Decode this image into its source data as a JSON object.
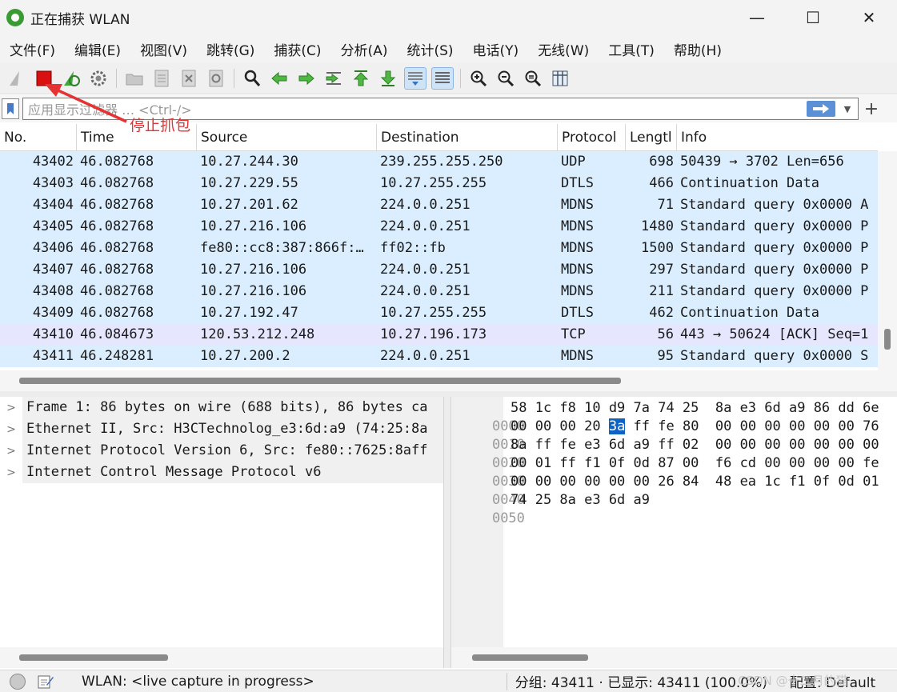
{
  "window": {
    "title": "正在捕获 WLAN",
    "minimize": "—",
    "maximize": "☐",
    "close": "✕"
  },
  "menu": [
    "文件(F)",
    "编辑(E)",
    "视图(V)",
    "跳转(G)",
    "捕获(C)",
    "分析(A)",
    "统计(S)",
    "电话(Y)",
    "无线(W)",
    "工具(T)",
    "帮助(H)"
  ],
  "filter": {
    "placeholder": "应用显示过滤器 … <Ctrl-/>",
    "add": "+"
  },
  "annotation": {
    "label": "停止抓包",
    "color": "#e53333"
  },
  "packet_list": {
    "columns": [
      "No.",
      "Time",
      "Source",
      "Destination",
      "Protocol",
      "Lengtl",
      "Info"
    ],
    "rows": [
      {
        "no": "43402",
        "time": "46.082768",
        "src": "10.27.244.30",
        "dst": "239.255.255.250",
        "proto": "UDP",
        "len": "698",
        "info": "50439 → 3702 Len=656",
        "kind": "udp"
      },
      {
        "no": "43403",
        "time": "46.082768",
        "src": "10.27.229.55",
        "dst": "10.27.255.255",
        "proto": "DTLS",
        "len": "466",
        "info": "Continuation Data",
        "kind": "udp"
      },
      {
        "no": "43404",
        "time": "46.082768",
        "src": "10.27.201.62",
        "dst": "224.0.0.251",
        "proto": "MDNS",
        "len": "71",
        "info": "Standard query 0x0000 A",
        "kind": "udp"
      },
      {
        "no": "43405",
        "time": "46.082768",
        "src": "10.27.216.106",
        "dst": "224.0.0.251",
        "proto": "MDNS",
        "len": "1480",
        "info": "Standard query 0x0000 P",
        "kind": "udp"
      },
      {
        "no": "43406",
        "time": "46.082768",
        "src": "fe80::cc8:387:866f:…",
        "dst": "ff02::fb",
        "proto": "MDNS",
        "len": "1500",
        "info": "Standard query 0x0000 P",
        "kind": "udp"
      },
      {
        "no": "43407",
        "time": "46.082768",
        "src": "10.27.216.106",
        "dst": "224.0.0.251",
        "proto": "MDNS",
        "len": "297",
        "info": "Standard query 0x0000 P",
        "kind": "udp"
      },
      {
        "no": "43408",
        "time": "46.082768",
        "src": "10.27.216.106",
        "dst": "224.0.0.251",
        "proto": "MDNS",
        "len": "211",
        "info": "Standard query 0x0000 P",
        "kind": "udp"
      },
      {
        "no": "43409",
        "time": "46.082768",
        "src": "10.27.192.47",
        "dst": "10.27.255.255",
        "proto": "DTLS",
        "len": "462",
        "info": "Continuation Data",
        "kind": "udp"
      },
      {
        "no": "43410",
        "time": "46.084673",
        "src": "120.53.212.248",
        "dst": "10.27.196.173",
        "proto": "TCP",
        "len": "56",
        "info": "443 → 50624 [ACK] Seq=1",
        "kind": "tcp"
      },
      {
        "no": "43411",
        "time": "46.248281",
        "src": "10.27.200.2",
        "dst": "224.0.0.251",
        "proto": "MDNS",
        "len": "95",
        "info": "Standard query 0x0000 S",
        "kind": "udp"
      }
    ],
    "colors": {
      "udp": "#daeeff",
      "tcp": "#e7e6ff"
    }
  },
  "details": [
    "Frame 1: 86 bytes on wire (688 bits), 86 bytes ca",
    "Ethernet II, Src: H3CTechnolog_e3:6d:a9 (74:25:8a",
    "Internet Protocol Version 6, Src: fe80::7625:8aff",
    "Internet Control Message Protocol v6"
  ],
  "bytes": [
    {
      "offset": "0000",
      "hex_a": "58 1c f8 10 d9 7a 74 25  8a e3 6d a9 86 dd 6e",
      "sel": "",
      "hex_b": ""
    },
    {
      "offset": "0010",
      "hex_a": "00 00 00 20 ",
      "sel": "3a",
      "hex_b": " ff fe 80  00 00 00 00 00 00 76"
    },
    {
      "offset": "0020",
      "hex_a": "8a ff fe e3 6d a9 ff 02  00 00 00 00 00 00 00",
      "sel": "",
      "hex_b": ""
    },
    {
      "offset": "0030",
      "hex_a": "00 01 ff f1 0f 0d 87 00  f6 cd 00 00 00 00 fe",
      "sel": "",
      "hex_b": ""
    },
    {
      "offset": "0040",
      "hex_a": "00 00 00 00 00 00 26 84  48 ea 1c f1 0f 0d 01",
      "sel": "",
      "hex_b": ""
    },
    {
      "offset": "0050",
      "hex_a": "74 25 8a e3 6d a9",
      "sel": "",
      "hex_b": ""
    }
  ],
  "status": {
    "interface": "WLAN: <live capture in progress>",
    "packets": "分组: 43411 · 已显示: 43411 (100.0%)",
    "profile": "配置: Default",
    "watermark": "CSDN @十二月的猫"
  }
}
